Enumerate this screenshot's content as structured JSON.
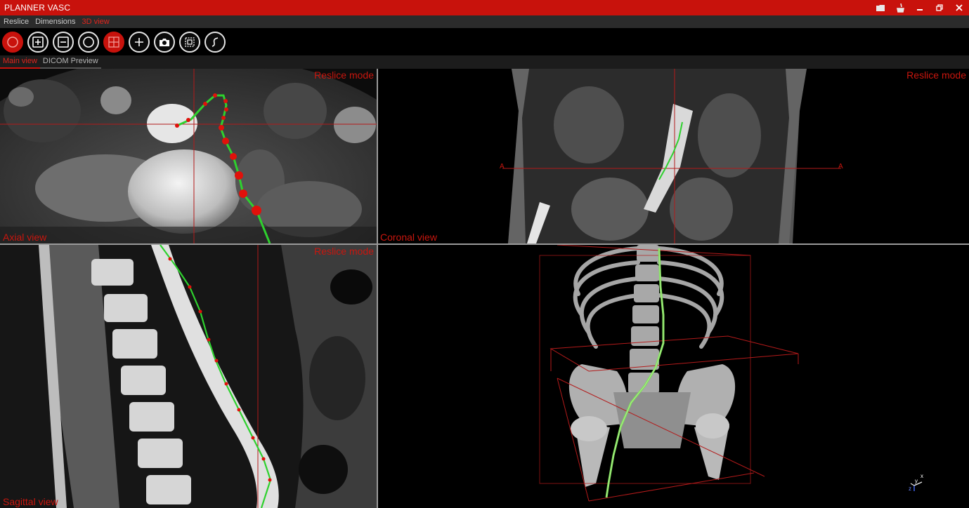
{
  "app": {
    "title": "PLANNER VASC"
  },
  "window_buttons": [
    {
      "name": "folder-icon",
      "glyph": "▬"
    },
    {
      "name": "broom-icon",
      "glyph": "⌂"
    },
    {
      "name": "minimize-icon",
      "glyph": "–"
    },
    {
      "name": "restore-icon",
      "glyph": "❐"
    },
    {
      "name": "close-icon",
      "glyph": "✕"
    }
  ],
  "menu": [
    {
      "label": "Reslice",
      "active": false
    },
    {
      "label": "Dimensions",
      "active": false
    },
    {
      "label": "3D view",
      "active": true
    }
  ],
  "toolbar": [
    {
      "name": "circle-select-tool-button",
      "icon": "red-circle-icon",
      "active": true
    },
    {
      "name": "zoom-in-button",
      "icon": "plus-square-icon",
      "active": false
    },
    {
      "name": "zoom-out-button",
      "icon": "minus-square-icon",
      "active": false
    },
    {
      "name": "ellipse-roi-button",
      "icon": "circle-outline-icon",
      "active": false
    },
    {
      "name": "layout-grid-button",
      "icon": "grid-icon",
      "active": true
    },
    {
      "name": "add-point-button",
      "icon": "plus-icon",
      "active": false
    },
    {
      "name": "snapshot-button",
      "icon": "camera-icon",
      "active": false
    },
    {
      "name": "crop-box-button",
      "icon": "crop-box-icon",
      "active": false
    },
    {
      "name": "centerline-curve-button",
      "icon": "curve-icon",
      "active": false
    }
  ],
  "view_tabs": [
    {
      "label": "Main view",
      "active": true
    },
    {
      "label": "DICOM Preview",
      "active": false
    }
  ],
  "panes": {
    "axial": {
      "mode_label": "Reslice mode",
      "view_label": "Axial view"
    },
    "coronal": {
      "mode_label": "Reslice mode",
      "view_label": "Coronal view",
      "marker_left": "A",
      "marker_right": "A"
    },
    "sagittal": {
      "mode_label": "Reslice mode",
      "view_label": "Sagittal view"
    },
    "volume": {
      "axes_x": "x",
      "axes_y": "y",
      "axes_z": "z"
    }
  },
  "colors": {
    "accent": "#c8120c",
    "centerline": "#2ed12e",
    "crosshair": "#b31a1a"
  }
}
